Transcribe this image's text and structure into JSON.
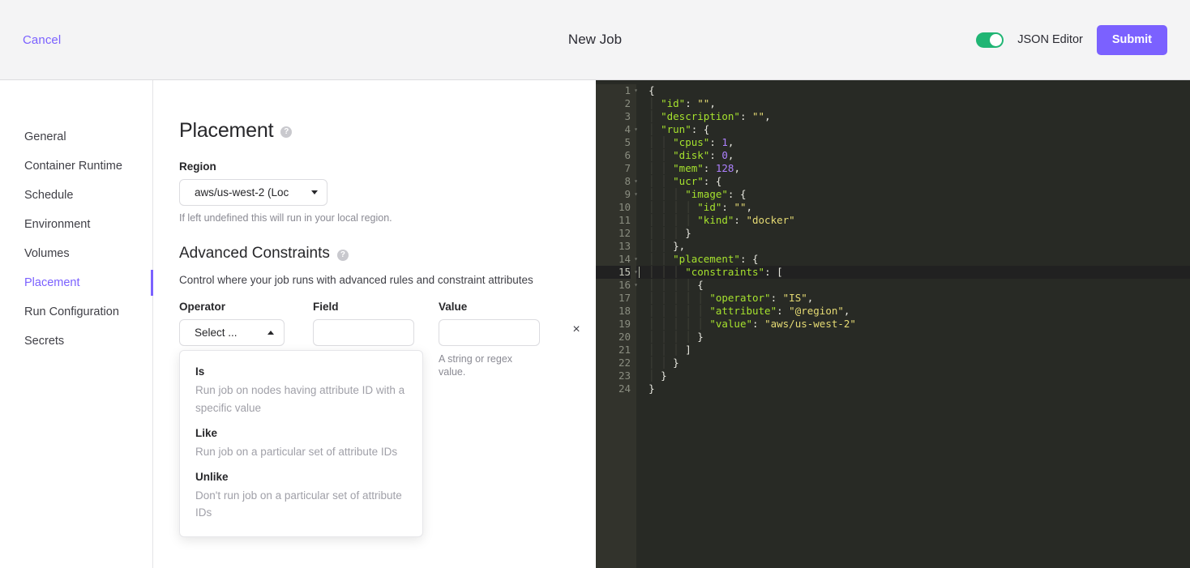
{
  "header": {
    "cancel_label": "Cancel",
    "title": "New Job",
    "toggle_label": "JSON Editor",
    "toggle_on": true,
    "submit_label": "Submit",
    "accent_color": "#7b61ff",
    "toggle_on_color": "#20b574"
  },
  "sidebar": {
    "items": [
      {
        "label": "General",
        "active": false
      },
      {
        "label": "Container Runtime",
        "active": false
      },
      {
        "label": "Schedule",
        "active": false
      },
      {
        "label": "Environment",
        "active": false
      },
      {
        "label": "Volumes",
        "active": false
      },
      {
        "label": "Placement",
        "active": true
      },
      {
        "label": "Run Configuration",
        "active": false
      },
      {
        "label": "Secrets",
        "active": false
      }
    ]
  },
  "main": {
    "placement": {
      "heading": "Placement",
      "help_icon": "question-mark-icon",
      "region_label": "Region",
      "region_value": "aws/us-west-2 (Loc",
      "region_hint": "If left undefined this will run in your local region."
    },
    "advanced": {
      "heading": "Advanced Constraints",
      "help_icon": "question-mark-icon",
      "description": "Control where your job runs with advanced rules and constraint attributes",
      "columns": {
        "operator": "Operator",
        "field": "Field",
        "value": "Value"
      },
      "operator_value": "Select ...",
      "field_value": "",
      "value_value": "",
      "value_hint": "A string or regex value.",
      "remove_label": "×",
      "options": [
        {
          "title": "Is",
          "desc": "Run job on nodes having attribute ID with a specific value"
        },
        {
          "title": "Like",
          "desc": "Run job on a particular set of attribute IDs"
        },
        {
          "title": "Unlike",
          "desc": "Don't run job on a particular set of attribute IDs"
        }
      ]
    }
  },
  "editor": {
    "active_line": 15,
    "theme": {
      "background": "#282a25",
      "gutter": "#32332c",
      "active_line": "#212121",
      "key": "#a6e22e",
      "string": "#e6db74",
      "number": "#ae81ff",
      "punctuation": "#e8e8e0"
    },
    "lines": [
      {
        "n": 1,
        "fold": true,
        "indent": 0,
        "tokens": [
          {
            "t": "punc",
            "v": "{"
          }
        ]
      },
      {
        "n": 2,
        "fold": false,
        "indent": 1,
        "tokens": [
          {
            "t": "key",
            "v": "\"id\""
          },
          {
            "t": "punc",
            "v": ": "
          },
          {
            "t": "str",
            "v": "\"\""
          },
          {
            "t": "punc",
            "v": ","
          }
        ]
      },
      {
        "n": 3,
        "fold": false,
        "indent": 1,
        "tokens": [
          {
            "t": "key",
            "v": "\"description\""
          },
          {
            "t": "punc",
            "v": ": "
          },
          {
            "t": "str",
            "v": "\"\""
          },
          {
            "t": "punc",
            "v": ","
          }
        ]
      },
      {
        "n": 4,
        "fold": true,
        "indent": 1,
        "tokens": [
          {
            "t": "key",
            "v": "\"run\""
          },
          {
            "t": "punc",
            "v": ": {"
          }
        ]
      },
      {
        "n": 5,
        "fold": false,
        "indent": 2,
        "tokens": [
          {
            "t": "key",
            "v": "\"cpus\""
          },
          {
            "t": "punc",
            "v": ": "
          },
          {
            "t": "num",
            "v": "1"
          },
          {
            "t": "punc",
            "v": ","
          }
        ]
      },
      {
        "n": 6,
        "fold": false,
        "indent": 2,
        "tokens": [
          {
            "t": "key",
            "v": "\"disk\""
          },
          {
            "t": "punc",
            "v": ": "
          },
          {
            "t": "num",
            "v": "0"
          },
          {
            "t": "punc",
            "v": ","
          }
        ]
      },
      {
        "n": 7,
        "fold": false,
        "indent": 2,
        "tokens": [
          {
            "t": "key",
            "v": "\"mem\""
          },
          {
            "t": "punc",
            "v": ": "
          },
          {
            "t": "num",
            "v": "128"
          },
          {
            "t": "punc",
            "v": ","
          }
        ]
      },
      {
        "n": 8,
        "fold": true,
        "indent": 2,
        "tokens": [
          {
            "t": "key",
            "v": "\"ucr\""
          },
          {
            "t": "punc",
            "v": ": {"
          }
        ]
      },
      {
        "n": 9,
        "fold": true,
        "indent": 3,
        "tokens": [
          {
            "t": "key",
            "v": "\"image\""
          },
          {
            "t": "punc",
            "v": ": {"
          }
        ]
      },
      {
        "n": 10,
        "fold": false,
        "indent": 4,
        "tokens": [
          {
            "t": "key",
            "v": "\"id\""
          },
          {
            "t": "punc",
            "v": ": "
          },
          {
            "t": "str",
            "v": "\"\""
          },
          {
            "t": "punc",
            "v": ","
          }
        ]
      },
      {
        "n": 11,
        "fold": false,
        "indent": 4,
        "tokens": [
          {
            "t": "key",
            "v": "\"kind\""
          },
          {
            "t": "punc",
            "v": ": "
          },
          {
            "t": "str",
            "v": "\"docker\""
          }
        ]
      },
      {
        "n": 12,
        "fold": false,
        "indent": 3,
        "tokens": [
          {
            "t": "punc",
            "v": "}"
          }
        ]
      },
      {
        "n": 13,
        "fold": false,
        "indent": 2,
        "tokens": [
          {
            "t": "punc",
            "v": "},"
          }
        ]
      },
      {
        "n": 14,
        "fold": true,
        "indent": 2,
        "tokens": [
          {
            "t": "key",
            "v": "\"placement\""
          },
          {
            "t": "punc",
            "v": ": {"
          }
        ]
      },
      {
        "n": 15,
        "fold": true,
        "indent": 3,
        "tokens": [
          {
            "t": "key",
            "v": "\"constraints\""
          },
          {
            "t": "punc",
            "v": ": ["
          }
        ]
      },
      {
        "n": 16,
        "fold": true,
        "indent": 4,
        "tokens": [
          {
            "t": "punc",
            "v": "{"
          }
        ]
      },
      {
        "n": 17,
        "fold": false,
        "indent": 5,
        "tokens": [
          {
            "t": "key",
            "v": "\"operator\""
          },
          {
            "t": "punc",
            "v": ": "
          },
          {
            "t": "str",
            "v": "\"IS\""
          },
          {
            "t": "punc",
            "v": ","
          }
        ]
      },
      {
        "n": 18,
        "fold": false,
        "indent": 5,
        "tokens": [
          {
            "t": "key",
            "v": "\"attribute\""
          },
          {
            "t": "punc",
            "v": ": "
          },
          {
            "t": "str",
            "v": "\"@region\""
          },
          {
            "t": "punc",
            "v": ","
          }
        ]
      },
      {
        "n": 19,
        "fold": false,
        "indent": 5,
        "tokens": [
          {
            "t": "key",
            "v": "\"value\""
          },
          {
            "t": "punc",
            "v": ": "
          },
          {
            "t": "str",
            "v": "\"aws/us-west-2\""
          }
        ]
      },
      {
        "n": 20,
        "fold": false,
        "indent": 4,
        "tokens": [
          {
            "t": "punc",
            "v": "}"
          }
        ]
      },
      {
        "n": 21,
        "fold": false,
        "indent": 3,
        "tokens": [
          {
            "t": "punc",
            "v": "]"
          }
        ]
      },
      {
        "n": 22,
        "fold": false,
        "indent": 2,
        "tokens": [
          {
            "t": "punc",
            "v": "}"
          }
        ]
      },
      {
        "n": 23,
        "fold": false,
        "indent": 1,
        "tokens": [
          {
            "t": "punc",
            "v": "}"
          }
        ]
      },
      {
        "n": 24,
        "fold": false,
        "indent": 0,
        "tokens": [
          {
            "t": "punc",
            "v": "}"
          }
        ]
      }
    ]
  }
}
